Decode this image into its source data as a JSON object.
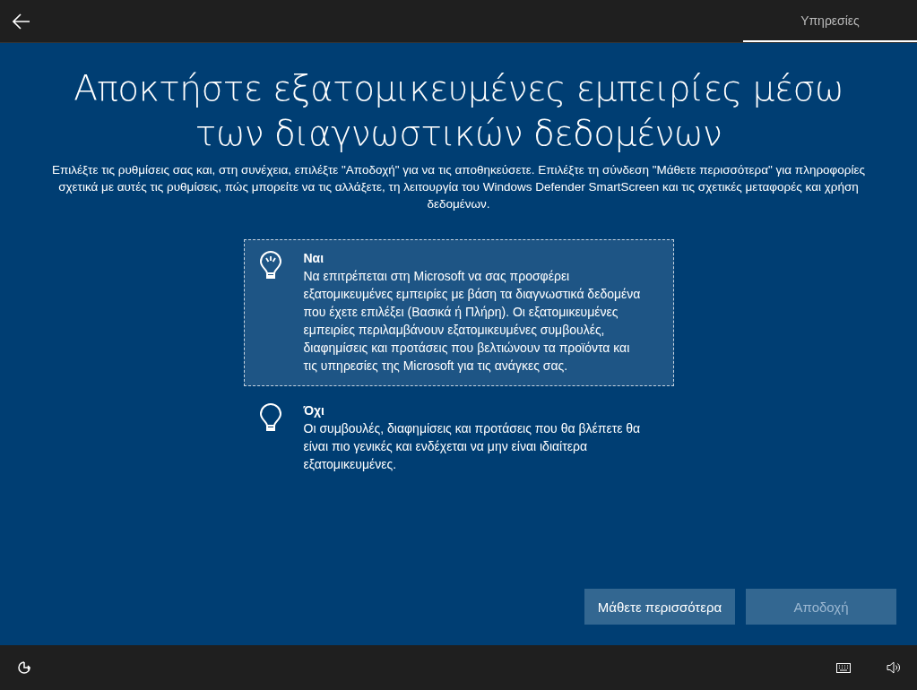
{
  "top_bar": {
    "tabs": [
      {
        "label": "Υπηρεσίες",
        "selected": true
      }
    ]
  },
  "title": "Αποκτήστε εξατομικευμένες εμπειρίες μέσω των διαγνωστικών δεδομένων",
  "description": "Επιλέξτε τις ρυθμίσεις σας και, στη συνέχεια, επιλέξτε \"Αποδοχή\" για να τις αποθηκεύσετε. Επιλέξτε τη σύνδεση \"Μάθετε περισσότερα\" για πληροφορίες σχετικά με αυτές τις ρυθμίσεις, πώς μπορείτε να τις αλλάξετε, τη λειτουργία του Windows Defender SmartScreen και τις σχετικές μεταφορές και χρήση δεδομένων.",
  "options": [
    {
      "title": "Ναι",
      "text": "Να επιτρέπεται στη Microsoft να σας προσφέρει εξατομικευμένες εμπειρίες με βάση τα διαγνωστικά δεδομένα που έχετε επιλέξει (Βασικά ή Πλήρη). Οι εξατομικευμένες εμπειρίες περιλαμβάνουν εξατομικευμένες συμβουλές, διαφημίσεις και προτάσεις που βελτιώνουν τα προϊόντα και τις υπηρεσίες της Microsoft για τις ανάγκες σας.",
      "selected": true
    },
    {
      "title": "Όχι",
      "text": "Οι συμβουλές, διαφημίσεις και προτάσεις που θα βλέπετε θα είναι πιο γενικές και ενδέχεται να μην είναι ιδιαίτερα εξατομικευμένες.",
      "selected": false
    }
  ],
  "buttons": [
    {
      "label": "Μάθετε περισσότερα",
      "disabled": false
    },
    {
      "label": "Αποδοχή",
      "disabled": true
    }
  ]
}
